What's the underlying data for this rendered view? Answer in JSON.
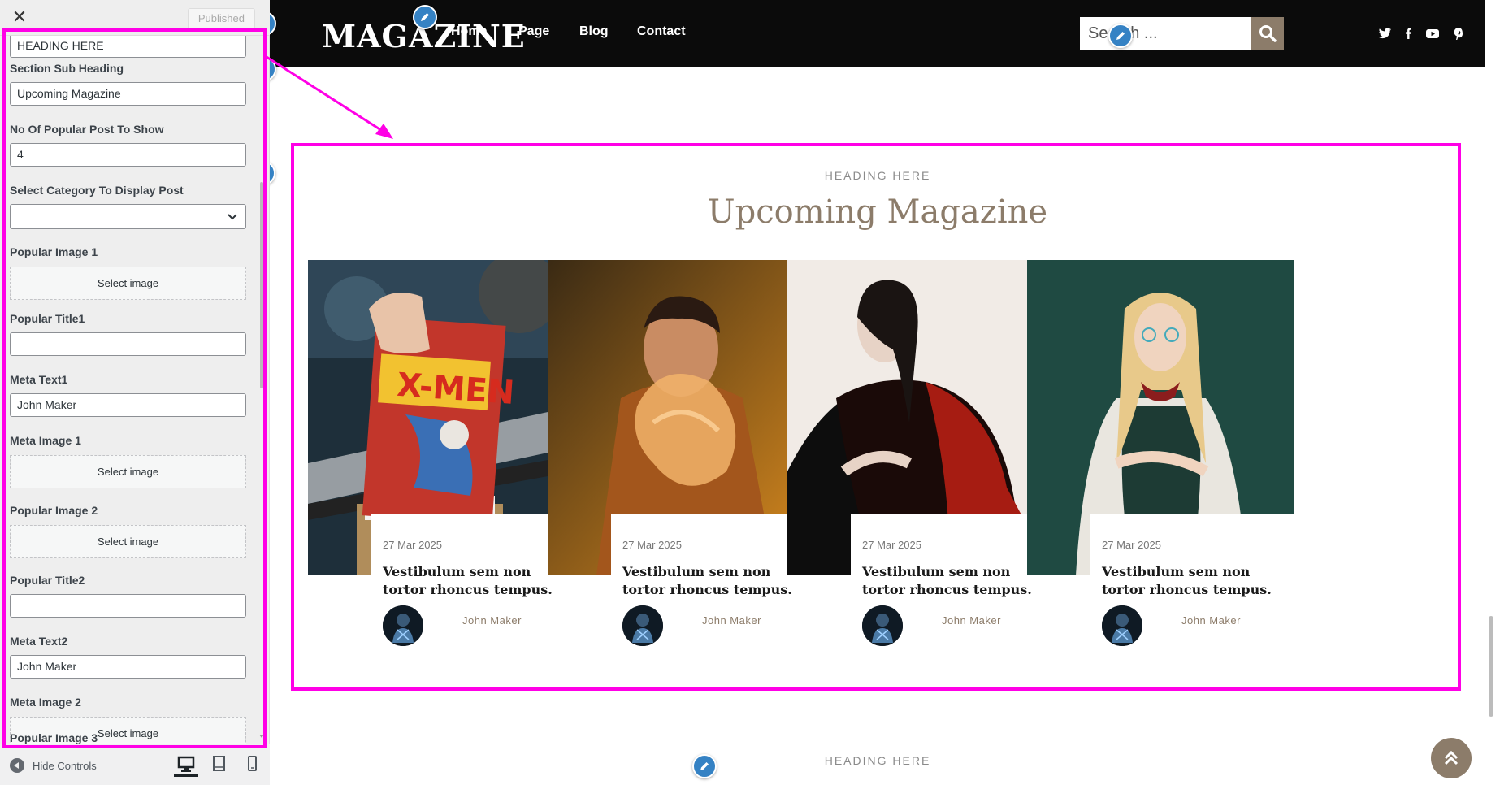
{
  "customizer": {
    "close_label": "✕",
    "publish_label": "Published",
    "fields": [
      {
        "label": "",
        "value": "HEADING HERE"
      },
      {
        "label": "Section Sub Heading",
        "value": "Upcoming Magazine"
      },
      {
        "label": "No Of Popular Post To Show",
        "value": "4"
      },
      {
        "label": "Select Category To Display Post",
        "value": ""
      },
      {
        "label": "Popular Image 1",
        "button": "Select image"
      },
      {
        "label": "Popular Title1",
        "value": ""
      },
      {
        "label": "Meta Text1",
        "value": "John Maker"
      },
      {
        "label": "Meta Image 1",
        "button": "Select image"
      },
      {
        "label": "Popular Image 2",
        "button": "Select image"
      },
      {
        "label": "Popular Title2",
        "value": ""
      },
      {
        "label": "Meta Text2",
        "value": "John Maker"
      },
      {
        "label": "Meta Image 2",
        "button": "Select image"
      },
      {
        "label": "Popular Image 3"
      }
    ],
    "footer": {
      "hide_controls": "Hide Controls"
    }
  },
  "site": {
    "logo": "MAGAZINE",
    "nav": [
      "Home",
      "Page",
      "Blog",
      "Contact"
    ],
    "search_placeholder": "Search ...",
    "social_icons": [
      "twitter-icon",
      "facebook-icon",
      "youtube-icon",
      "pinterest-icon"
    ]
  },
  "section": {
    "eyebrow": "HEADING HERE",
    "title": "Upcoming Magazine",
    "posts": [
      {
        "date": "27 Mar 2025",
        "title": "Vestibulum sem non tortor rhoncus tempus.",
        "author": "John Maker"
      },
      {
        "date": "27 Mar 2025",
        "title": "Vestibulum sem non tortor rhoncus tempus.",
        "author": "John Maker"
      },
      {
        "date": "27 Mar 2025",
        "title": "Vestibulum sem non tortor rhoncus tempus.",
        "author": "John Maker"
      },
      {
        "date": "27 Mar 2025",
        "title": "Vestibulum sem non tortor rhoncus tempus.",
        "author": "John Maker"
      }
    ]
  },
  "next_section": {
    "eyebrow": "HEADING HERE"
  },
  "colors": {
    "accent": "#8c7c6a",
    "highlight": "#ff00e6",
    "edit_pin": "#3582c4",
    "header_bg": "#0b0b0b"
  }
}
